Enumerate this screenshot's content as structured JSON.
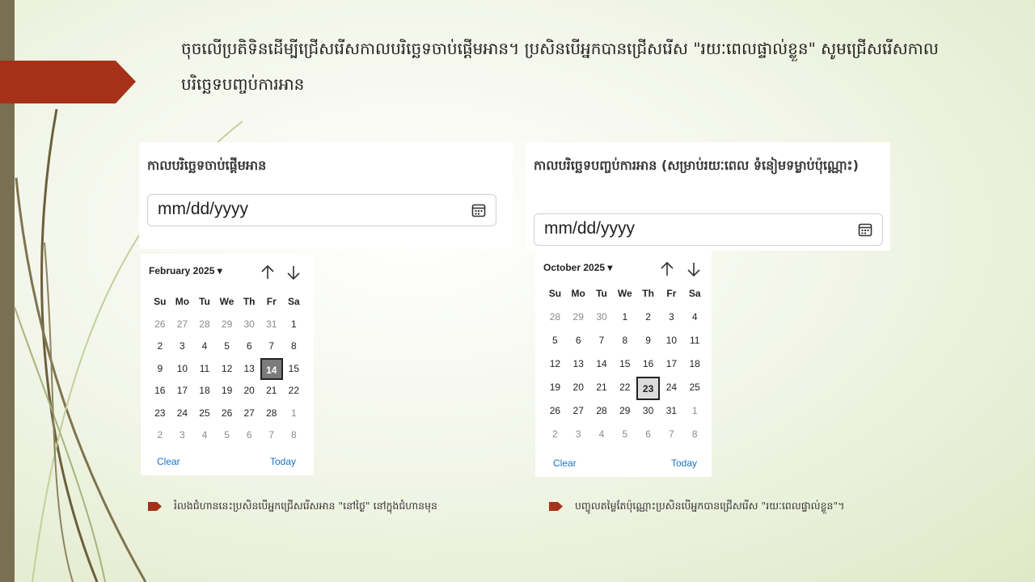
{
  "slide": {
    "title": "ចុចលើប្រតិទិនដើម្បីជ្រើសរើសកាលបរិច្ឆេទចាប់ផ្តើមអាន។  ប្រសិនបើអ្នកបានជ្រើសរើស  \"រយៈពេលផ្ទាល់ខ្លួន\"  សូមជ្រើសរើសកាលបរិច្ឆេទបញ្ចប់ការអាន",
    "colors": {
      "accent": "#a53218",
      "sidebar": "#7a6f52",
      "link": "#1a73c8"
    }
  },
  "start": {
    "label": "កាលបរិច្ឆេទចាប់ផ្តើមអាន",
    "input_value": "mm/dd/yyyy",
    "icon": "calendar-icon",
    "calendar": {
      "month_label": "February 2025",
      "weekdays": [
        "Su",
        "Mo",
        "Tu",
        "We",
        "Th",
        "Fr",
        "Sa"
      ],
      "days": [
        "26",
        "27",
        "28",
        "29",
        "30",
        "31",
        "1",
        "2",
        "3",
        "4",
        "5",
        "6",
        "7",
        "8",
        "9",
        "10",
        "11",
        "12",
        "13",
        "14",
        "15",
        "16",
        "17",
        "18",
        "19",
        "20",
        "21",
        "22",
        "23",
        "24",
        "25",
        "26",
        "27",
        "28",
        "1",
        "2",
        "3",
        "4",
        "5",
        "6",
        "7",
        "8"
      ],
      "selected": "14",
      "clear": "Clear",
      "today": "Today"
    },
    "note": "រំលងជំហាននេះប្រសិនបើអ្នកជ្រើសរើសអាន  \"នៅថ្ងៃ\"  នៅក្នុងជំហានមុន"
  },
  "end": {
    "label": "កាលបរិច្ឆេទបញ្ចប់ការអាន (សម្រាប់រយៈពេល ទំនៀមទម្លាប់ប៉ុណ្ណោះ)",
    "input_value": "mm/dd/yyyy",
    "icon": "calendar-icon",
    "calendar": {
      "month_label": "October 2025",
      "weekdays": [
        "Su",
        "Mo",
        "Tu",
        "We",
        "Th",
        "Fr",
        "Sa"
      ],
      "days": [
        "28",
        "29",
        "30",
        "1",
        "2",
        "3",
        "4",
        "5",
        "6",
        "7",
        "8",
        "9",
        "10",
        "11",
        "12",
        "13",
        "14",
        "15",
        "16",
        "17",
        "18",
        "19",
        "20",
        "21",
        "22",
        "23",
        "24",
        "25",
        "26",
        "27",
        "28",
        "29",
        "30",
        "31",
        "1",
        "2",
        "3",
        "4",
        "5",
        "6",
        "7",
        "8"
      ],
      "selected": "23",
      "clear": "Clear",
      "today": "Today"
    },
    "note": "បញ្ចូលតម្លៃតែប៉ុណ្ណោះប្រសិនបើអ្នកបានជ្រើសរើស  \"រយៈពេលផ្ទាល់ខ្លួន\"។"
  }
}
